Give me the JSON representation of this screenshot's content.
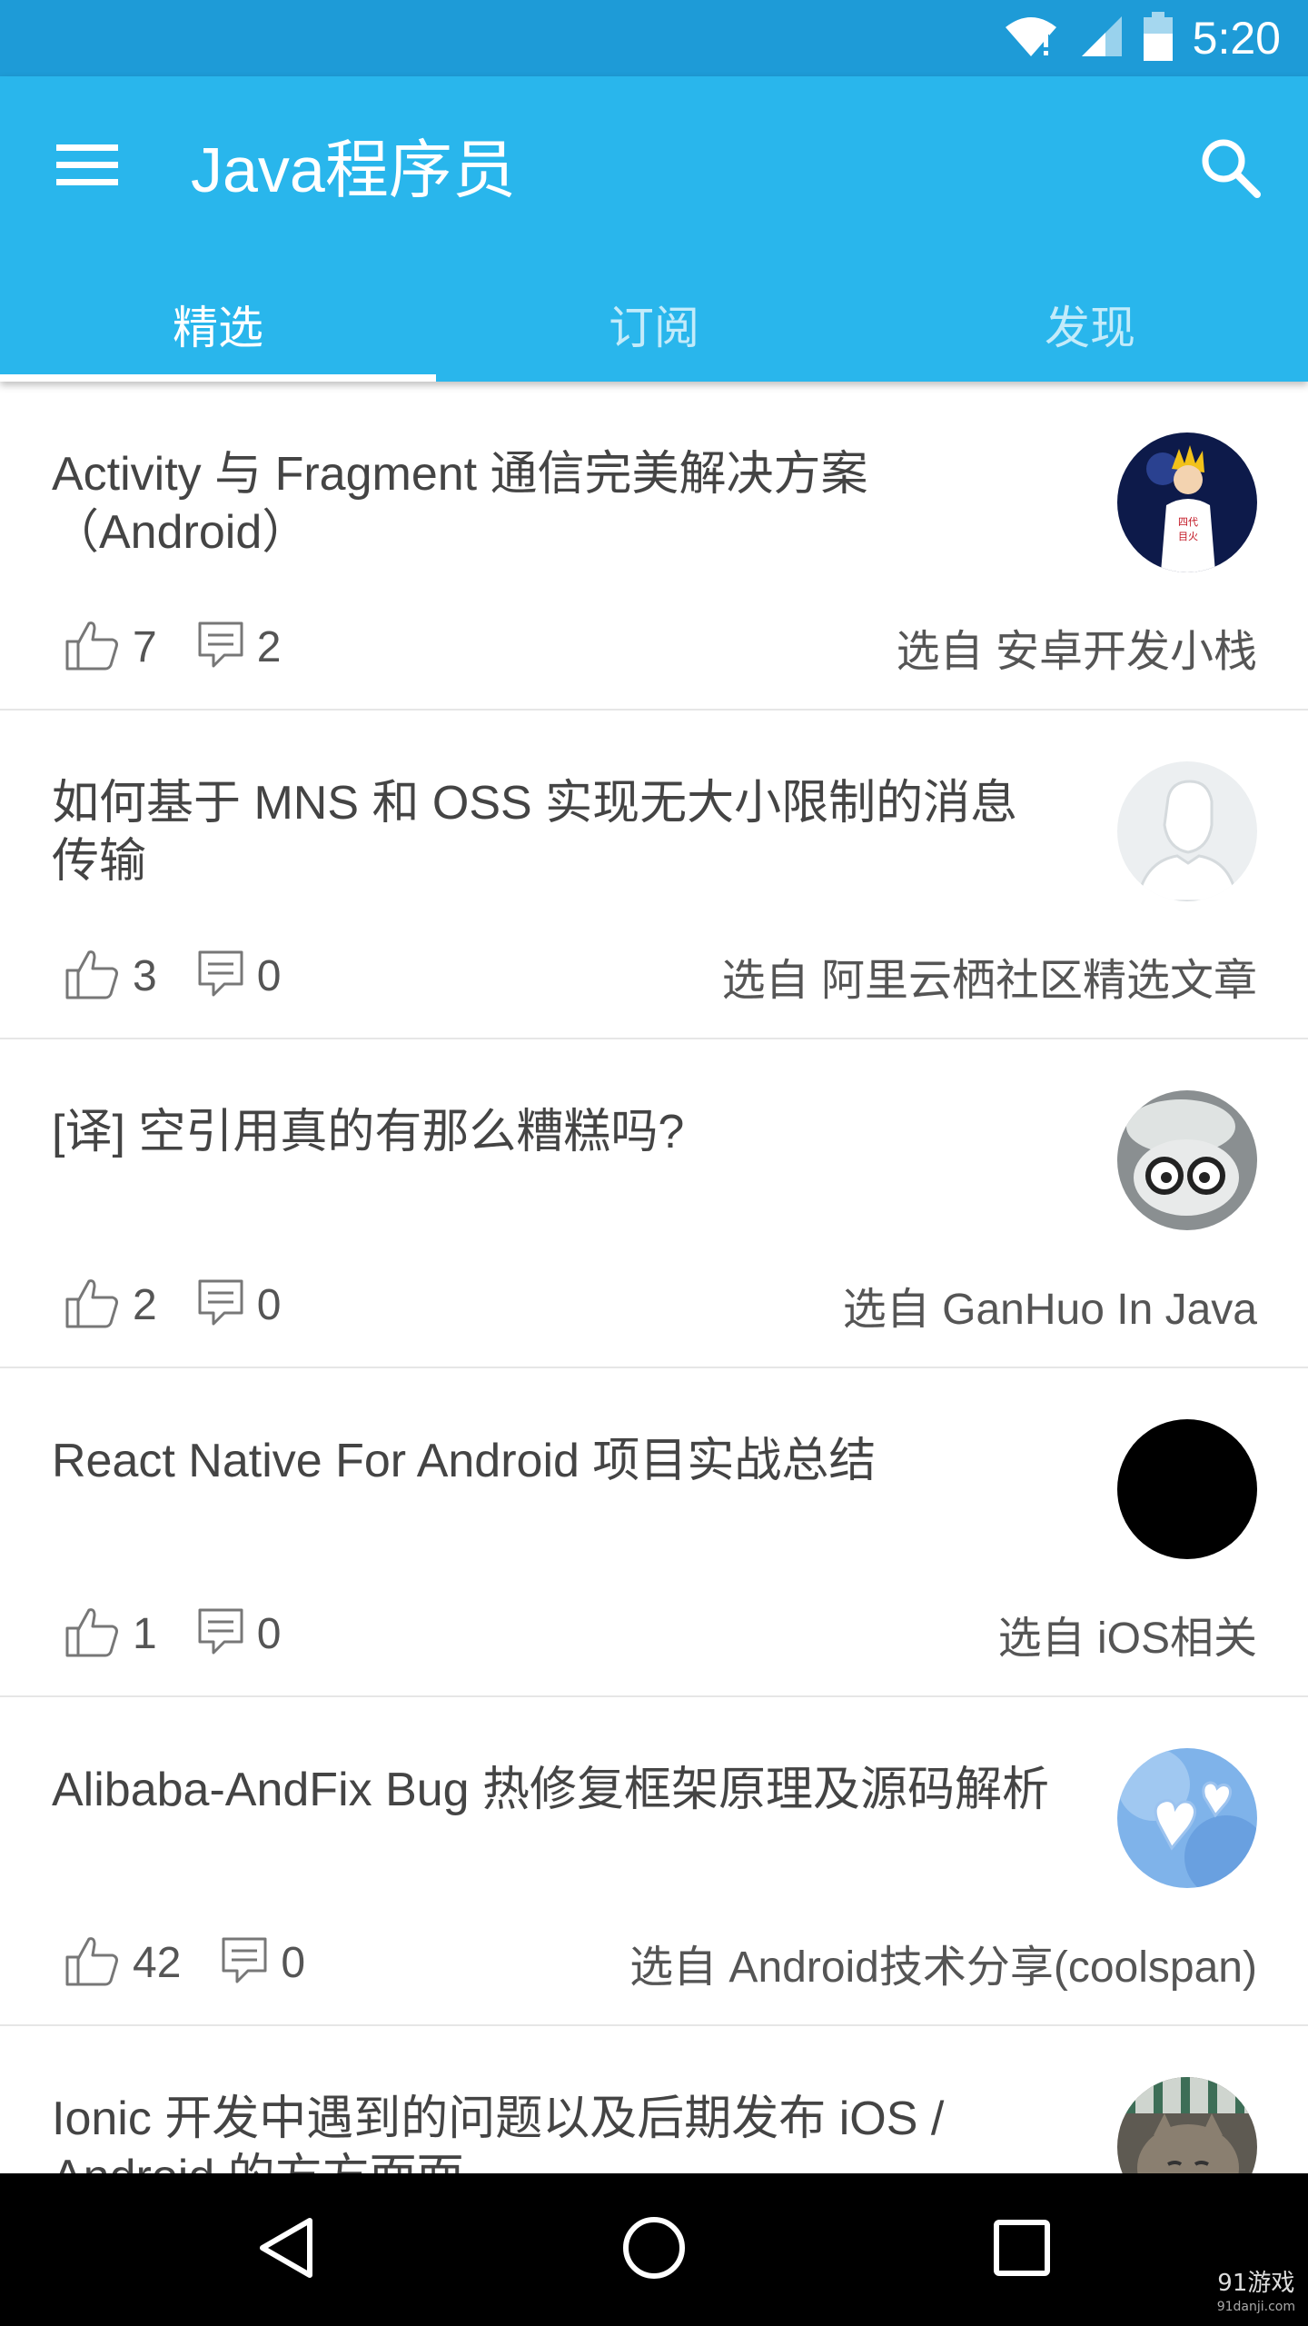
{
  "status_bar": {
    "time": "5:20"
  },
  "app_bar": {
    "title": "Java程序员"
  },
  "tabs": [
    {
      "label": "精选",
      "active": true
    },
    {
      "label": "订阅",
      "active": false
    },
    {
      "label": "发现",
      "active": false
    }
  ],
  "feed": [
    {
      "title": "Activity 与 Fragment 通信完美解决方案（Android）",
      "likes": "7",
      "comments": "2",
      "source": "选自 安卓开发小栈",
      "avatar": "anime-character-avatar"
    },
    {
      "title": "如何基于 MNS 和 OSS 实现无大小限制的消息传输",
      "likes": "3",
      "comments": "0",
      "source": "选自 阿里云栖社区精选文章",
      "avatar": "default-user-avatar"
    },
    {
      "title": "[译] 空引用真的有那么糟糕吗?",
      "likes": "2",
      "comments": "0",
      "source": "选自 GanHuo In Java",
      "avatar": "glasses-character-avatar"
    },
    {
      "title": "React Native For Android 项目实战总结",
      "likes": "1",
      "comments": "0",
      "source": "选自  iOS相关",
      "avatar": "black-avatar"
    },
    {
      "title": "Alibaba-AndFix Bug 热修复框架原理及源码解析",
      "likes": "42",
      "comments": "0",
      "source": "选自 Android技术分享(coolspan)",
      "avatar": "heart-avatar"
    },
    {
      "title": "Ionic 开发中遇到的问题以及后期发布 iOS / Android 的方方面面",
      "likes": "",
      "comments": "",
      "source": "",
      "avatar": "cat-avatar"
    }
  ],
  "watermark": {
    "main": "91游戏",
    "sub": "91danji.com"
  },
  "colors": {
    "primary": "#29b6ec",
    "status_bar": "#1e9bd7"
  }
}
